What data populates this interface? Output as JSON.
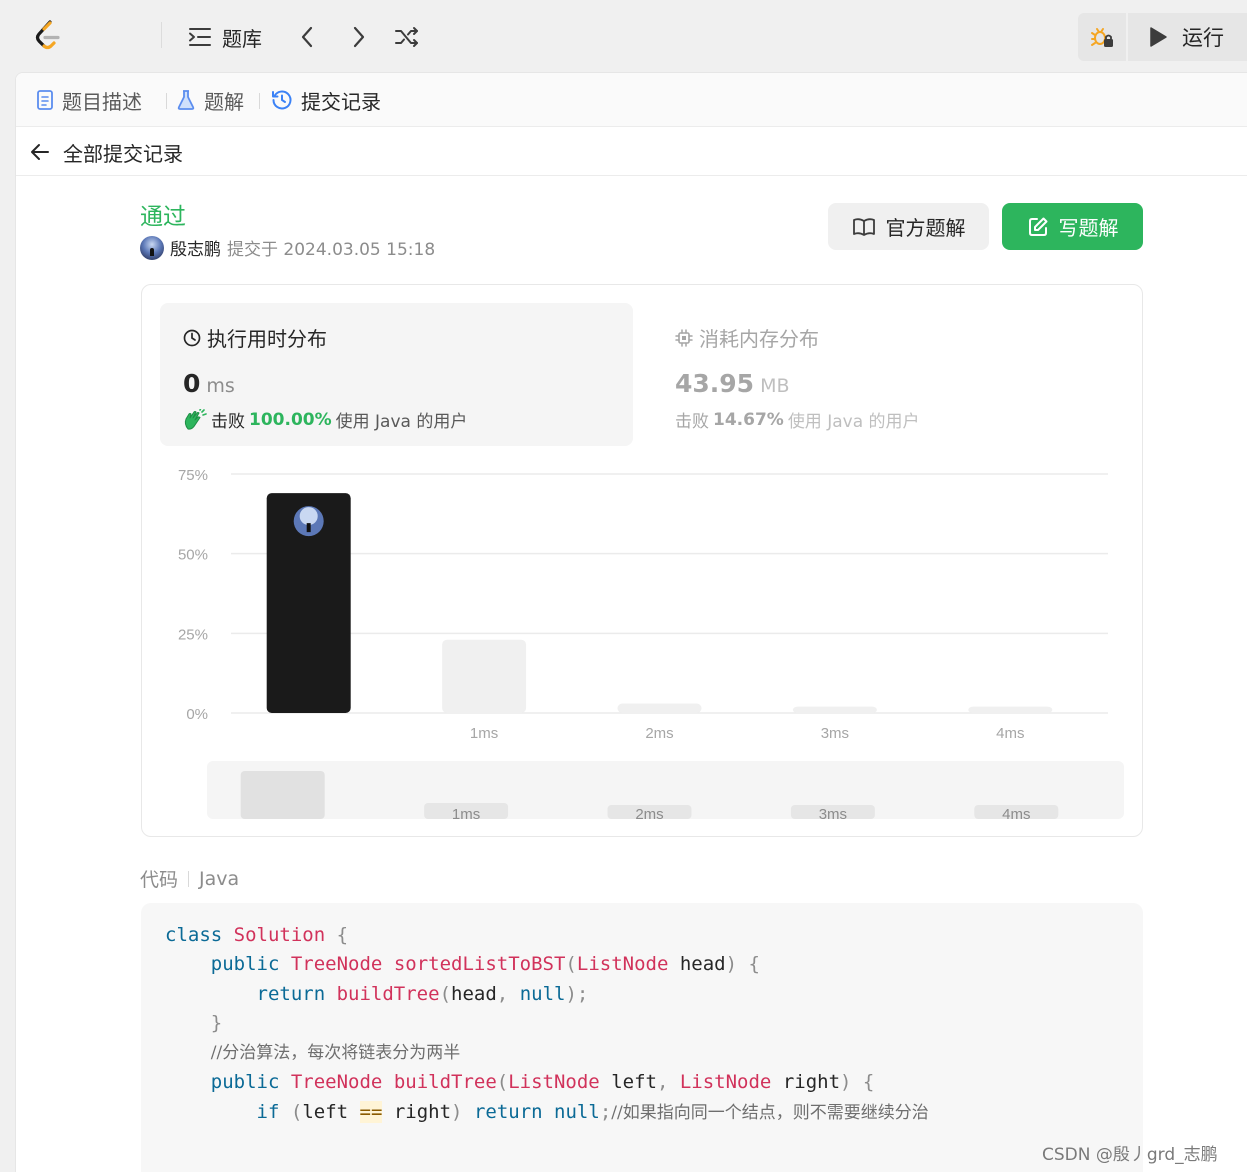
{
  "topbar": {
    "problem_list_label": "题库",
    "run_label": "运行"
  },
  "tabs": [
    {
      "label": "题目描述"
    },
    {
      "label": "题解"
    },
    {
      "label": "提交记录"
    }
  ],
  "back_label": "全部提交记录",
  "submission": {
    "status": "通过",
    "user": "殷志鹏",
    "submitted_at": "提交于 2024.03.05 15:18"
  },
  "actions": {
    "official_solution": "官方题解",
    "write_solution": "写题解"
  },
  "runtime": {
    "title": "执行用时分布",
    "value": "0",
    "unit": "ms",
    "beat_prefix": "击败",
    "beat_pct": "100.00%",
    "beat_suffix": "使用 Java 的用户"
  },
  "memory": {
    "title": "消耗内存分布",
    "value": "43.95",
    "unit": "MB",
    "beat_prefix": "击败",
    "beat_pct": "14.67%",
    "beat_suffix": "使用 Java 的用户"
  },
  "chart_data": {
    "type": "bar",
    "categories": [
      "0ms",
      "1ms",
      "2ms",
      "3ms",
      "4ms"
    ],
    "x_tick_labels": [
      "",
      "1ms",
      "2ms",
      "3ms",
      "4ms"
    ],
    "values": [
      69,
      23,
      3,
      2,
      2
    ],
    "y_ticks": [
      "0%",
      "25%",
      "50%",
      "75%"
    ],
    "ylim": [
      0,
      75
    ],
    "highlight_index": 0,
    "grid": true,
    "colors": {
      "highlight": "#1a1a1a",
      "bar": "#f0f0f0",
      "grid": "#ebebeb"
    },
    "navigator": {
      "x_tick_labels": [
        "",
        "1ms",
        "2ms",
        "3ms",
        "4ms"
      ]
    }
  },
  "code": {
    "label": "代码",
    "language": "Java"
  },
  "watermark": "CSDN @殷丿grd_志鹏",
  "colors": {
    "accent": "#2db55d",
    "keyword": "#0b6a96",
    "type": "#d1325b"
  }
}
